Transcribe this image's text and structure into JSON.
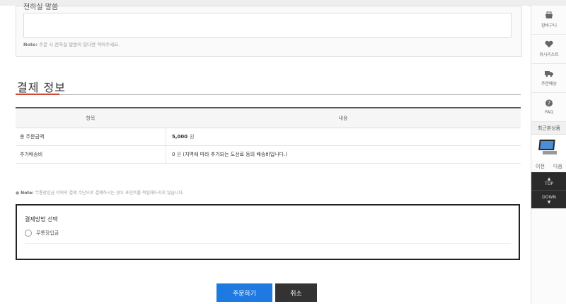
{
  "message": {
    "title": "전하실 말씀",
    "note_label": "Note:",
    "note_text": "주문 시 전하실 말씀이 있다면 적어주세요."
  },
  "payment_info": {
    "section_title": "결제 정보",
    "table_headers": [
      "항목",
      "내용"
    ],
    "rows": [
      {
        "label": "총 주문금액",
        "value": "5,000",
        "unit": "원",
        "extra": ""
      },
      {
        "label": "추가배송비",
        "value": "0",
        "unit": "원",
        "extra": "(지역에 따라 추가되는 도선료 등의 배송비입니다.)"
      }
    ],
    "note_label": "Note:",
    "note_text": "무통장입금 이외의 결제 수단으로 결제하시는 경우 포인트를 적립해드리지 않습니다."
  },
  "payment_method": {
    "title": "결제방법 선택",
    "option": "무통장입금"
  },
  "buttons": {
    "order": "주문하기",
    "cancel": "취소"
  },
  "quick_menu": {
    "items": [
      {
        "label": "장바구니",
        "icon": "basket-icon"
      },
      {
        "label": "위시리스트",
        "icon": "heart-icon"
      },
      {
        "label": "주문배송",
        "icon": "truck-icon"
      },
      {
        "label": "FAQ",
        "icon": "question-icon"
      }
    ],
    "recent_title": "최근본상품",
    "prev": "이전",
    "next": "다음",
    "top": "TOP",
    "down": "DOWN"
  },
  "colors": {
    "accent_red": "#d04a3a",
    "order_blue": "#1e7ae0",
    "cancel_dark": "#333333"
  }
}
